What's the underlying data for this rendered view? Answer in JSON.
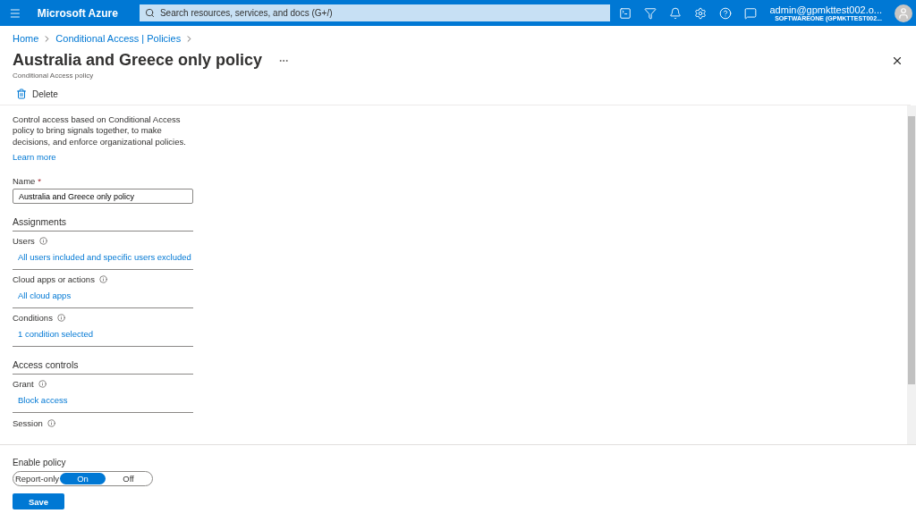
{
  "topbar": {
    "brand": "Microsoft Azure",
    "search_placeholder": "Search resources, services, and docs (G+/)",
    "account": "admin@gpmkttest002.o...",
    "tenant": "SOFTWAREONE (GPMKTTEST002..."
  },
  "breadcrumb": [
    "Home",
    "Conditional Access | Policies"
  ],
  "title": "Australia and Greece only policy",
  "subtitle": "Conditional Access policy",
  "toolbar": {
    "delete": "Delete"
  },
  "description": "Control access based on Conditional Access policy to bring signals together, to make decisions, and enforce organizational policies.",
  "learn_more": "Learn more",
  "name_field": {
    "label": "Name",
    "required": "*",
    "value": "Australia and Greece only policy"
  },
  "sections": [
    {
      "heading": "Assignments",
      "items": [
        {
          "label": "Users",
          "value": "All users included and specific users excluded"
        },
        {
          "label": "Cloud apps or actions",
          "value": "All cloud apps"
        },
        {
          "label": "Conditions",
          "value": "1 condition selected"
        }
      ]
    },
    {
      "heading": "Access controls",
      "items": [
        {
          "label": "Grant",
          "value": "Block access"
        },
        {
          "label": "Session"
        }
      ]
    }
  ],
  "enable_policy": {
    "label": "Enable policy",
    "options": [
      {
        "label": "Report-only",
        "selected": false
      },
      {
        "label": "On",
        "selected": true
      },
      {
        "label": "Off",
        "selected": false
      }
    ]
  },
  "save": "Save"
}
